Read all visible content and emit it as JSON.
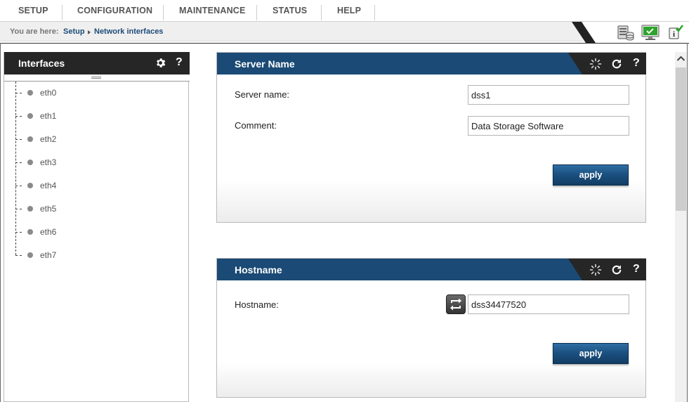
{
  "menu": {
    "items": [
      {
        "label": "SETUP"
      },
      {
        "label": "CONFIGURATION"
      },
      {
        "label": "MAINTENANCE"
      },
      {
        "label": "STATUS"
      },
      {
        "label": "HELP"
      }
    ]
  },
  "breadcrumb": {
    "prefix": "You are here:",
    "items": [
      {
        "label": "Setup"
      },
      {
        "label": "Network interfaces"
      }
    ]
  },
  "top_icons": [
    "database-icon",
    "monitor-check-icon",
    "info-check-icon"
  ],
  "left_panel": {
    "title": "Interfaces",
    "help": "?",
    "interfaces": [
      {
        "label": "eth0"
      },
      {
        "label": "eth1"
      },
      {
        "label": "eth2"
      },
      {
        "label": "eth3"
      },
      {
        "label": "eth4"
      },
      {
        "label": "eth5"
      },
      {
        "label": "eth6"
      },
      {
        "label": "eth7"
      }
    ]
  },
  "server_name_panel": {
    "title": "Server Name",
    "help": "?",
    "server_name_label": "Server name:",
    "server_name_value": "dss1",
    "comment_label": "Comment:",
    "comment_value": "Data Storage Software",
    "apply_label": "apply"
  },
  "hostname_panel": {
    "title": "Hostname",
    "help": "?",
    "hostname_label": "Hostname:",
    "hostname_value": "dss34477520",
    "apply_label": "apply"
  },
  "colors": {
    "panel_header": "#1a4a75",
    "dark_header": "#262626",
    "accent_green": "#2aa52a"
  }
}
